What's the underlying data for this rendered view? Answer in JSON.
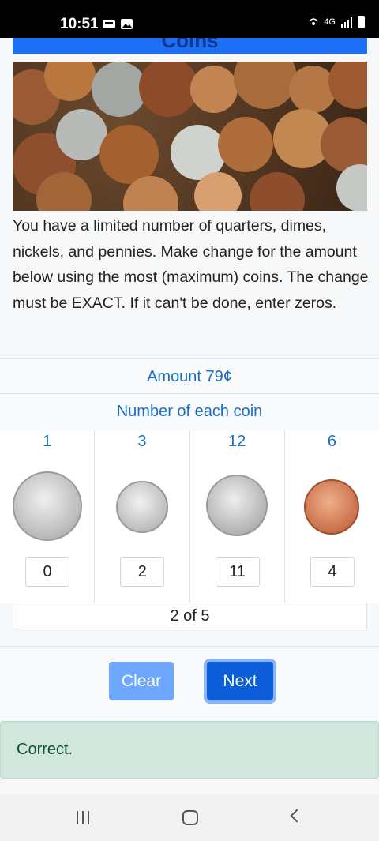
{
  "status": {
    "time": "10:51",
    "network": "4G"
  },
  "header": {
    "title": "Coins"
  },
  "instructions": "You have a limited number of quarters, dimes, nickels, and pennies. Make change for the amount below using the most (maximum) coins. The change must be EXACT. If it can't be done, enter zeros.",
  "amount_label": "Amount 79¢",
  "number_label": "Number of each coin",
  "coins": [
    {
      "name": "quarter",
      "available": "1",
      "entered": "0"
    },
    {
      "name": "dime",
      "available": "3",
      "entered": "2"
    },
    {
      "name": "nickel",
      "available": "12",
      "entered": "11"
    },
    {
      "name": "penny",
      "available": "6",
      "entered": "4"
    }
  ],
  "progress": "2 of 5",
  "buttons": {
    "clear": "Clear",
    "next": "Next"
  },
  "feedback": "Correct.",
  "colors": {
    "accent": "#0b5ed7",
    "header": "#1e6ff5",
    "link_text": "#1a6fc4",
    "success_bg": "#d1e7dd",
    "success_text": "#0f5132"
  }
}
